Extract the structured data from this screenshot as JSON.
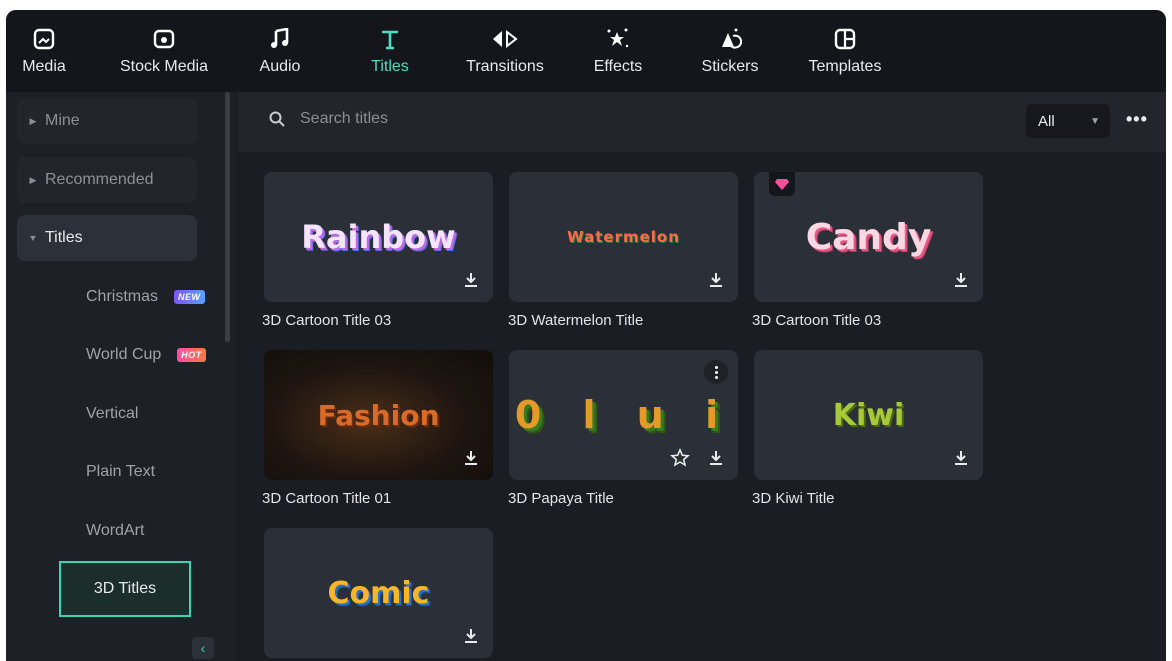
{
  "toolbar": {
    "items": [
      {
        "label": "Media",
        "icon": "media-icon"
      },
      {
        "label": "Stock Media",
        "icon": "stock-media-icon"
      },
      {
        "label": "Audio",
        "icon": "music-note-icon"
      },
      {
        "label": "Titles",
        "icon": "text-t-icon",
        "active": true
      },
      {
        "label": "Transitions",
        "icon": "transitions-icon"
      },
      {
        "label": "Effects",
        "icon": "effects-sparkle-icon"
      },
      {
        "label": "Stickers",
        "icon": "sticker-icon"
      },
      {
        "label": "Templates",
        "icon": "template-icon"
      }
    ]
  },
  "sidebar": {
    "groups": [
      {
        "label": "Mine",
        "expanded": false
      },
      {
        "label": "Recommended",
        "expanded": false
      },
      {
        "label": "Titles",
        "expanded": true
      }
    ],
    "items": [
      {
        "label": "Christmas",
        "badge": "NEW"
      },
      {
        "label": "World Cup",
        "badge": "HOT"
      },
      {
        "label": "Vertical"
      },
      {
        "label": "Plain Text"
      },
      {
        "label": "WordArt"
      },
      {
        "label": "3D Titles",
        "selected": true
      }
    ]
  },
  "search": {
    "placeholder": "Search titles"
  },
  "filter": {
    "value": "All"
  },
  "cards": [
    {
      "caption": "3D Cartoon Title 03",
      "preview_text": "Rainbow"
    },
    {
      "caption": "3D Watermelon Title",
      "preview_text": "Watermelon"
    },
    {
      "caption": "3D Cartoon Title 03",
      "preview_text": "Candy",
      "premium": true
    },
    {
      "caption": "3D Cartoon Title 01",
      "preview_text": "Fashion"
    },
    {
      "caption": "3D Papaya Title",
      "preview_text": "0 l u i",
      "hovered": true
    },
    {
      "caption": "3D Kiwi Title",
      "preview_text": "Kiwi"
    },
    {
      "caption": "",
      "preview_text": "Comic"
    }
  ],
  "colors": {
    "accent": "#4fdcc4",
    "selected_border": "#3ad5b2",
    "background": "#1a1d23",
    "card": "#2b2f37"
  }
}
